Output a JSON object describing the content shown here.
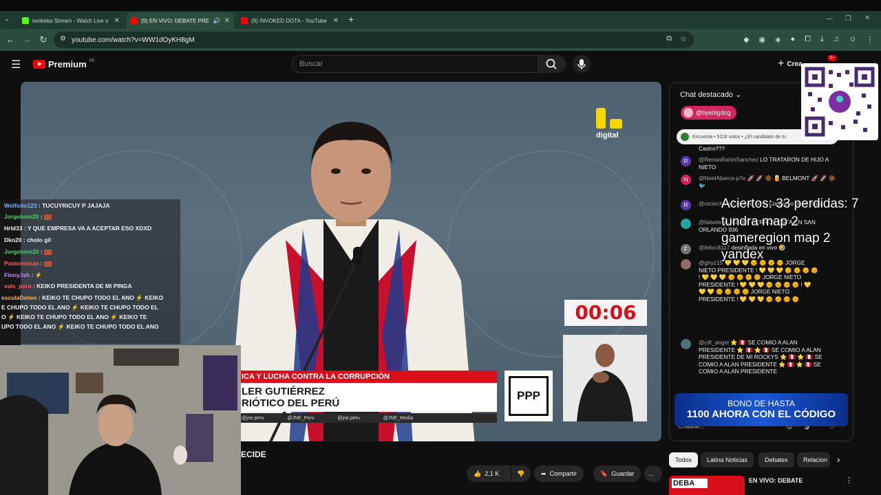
{
  "browser": {
    "tabs": [
      {
        "title": "iwobeka Stream - Watch Live o",
        "fav_color": "#53fc18"
      },
      {
        "title": "(9) EN VIVO: DEBATE PRESI",
        "fav_color": "#ff0000"
      },
      {
        "title": "(9) INVOKED DOTA - YouTube",
        "fav_color": "#ff0000"
      }
    ],
    "new_tab": "+",
    "url": "youtube.com/watch?v=WW1dOyKH8gM"
  },
  "youtube": {
    "logo_text": "Premium",
    "logo_badge": "PE",
    "search_placeholder": "Buscar",
    "create_label": "Crea",
    "notif_count": "9+"
  },
  "video": {
    "timer": "00:06",
    "lower_third_top": "ICA Y LUCHA CONTRA LA CORRUPCIÓN",
    "lower_third_name": "LER GUTIÉRREZ",
    "lower_third_party": "RIÓTICO DEL PERÚ",
    "social": [
      "@jne.peru",
      "@JNE_Peru",
      "@jne.peru",
      "@JNE_Media"
    ],
    "party_logo": "PPP",
    "channel_logo_text": "digital"
  },
  "stream_chat": [
    {
      "user": "Wolfsito123",
      "text": "TUCUYRICUY P JAJAJA",
      "color": "#7fb4ff"
    },
    {
      "user": "Jorgeboni20",
      "text": "",
      "color": "#4fd16b"
    },
    {
      "user": "Hrld33",
      "text": "Y QUE EMPRESA VA A ACEPTAR ESO XDXD",
      "color": "#f1f1f1"
    },
    {
      "user": "Dkn20",
      "text": "cholo gil",
      "color": "#f1f1f1"
    },
    {
      "user": "Jorgeboni20",
      "text": "",
      "color": "#4fd16b"
    },
    {
      "user": "Pantomimas",
      "text": "",
      "color": "#ff5c5c"
    },
    {
      "user": "FinnyJsh",
      "text": "",
      "color": "#c58cff"
    },
    {
      "user": "vals_peru",
      "text": "KEIKO PRESIDENTA DE MI PINGA",
      "color": "#ff5c5c"
    },
    {
      "user": "esculaDelwo",
      "text": "KEIKO TE CHUPO TODO EL ANO",
      "color": "#ffb347"
    }
  ],
  "stream_chat_wrap": [
    "KEIKO",
    "E CHUPO TODO EL ANO",
    "KEIKO TE CHUPO TODO EL",
    "O",
    "KEIKO TE CHUPO TODO EL ANO",
    "KEIKO TE",
    "UPO TODO EL ANO",
    "KEIKO TE CHUPO TODO EL ANO"
  ],
  "below_video": {
    "title_fragment": "ECIDE",
    "likes": "2,1 K",
    "share": "Compartir",
    "save": "Guardar",
    "more": "..."
  },
  "chat_panel": {
    "header": "Chat destacado",
    "pinned_user": "@byebigdog",
    "poll_text": "Encuesta • 5118 votos • ¿El candidato de tu",
    "messages": [
      {
        "user": "",
        "text": "Castro???",
        "avatar": "",
        "avatar_color": "#5b5b5b"
      },
      {
        "user": "@RenanRahinSanchez",
        "text": "LO TRATARON DE HIJO A NIETO",
        "avatar": "R",
        "avatar_color": "#5e35b1"
      },
      {
        "user": "@NoelAbarca-p7e",
        "text": "🚀 🚀 🔆 🥫 BELMONT 🚀 🚀 🔆 🐦",
        "avatar": "N",
        "avatar_color": "#d81b60"
      },
      {
        "user": "@rociochavez",
        "text": "lavado en el Congreso de la mafia",
        "avatar": "R",
        "avatar_color": "#5e35b1"
      },
      {
        "user": "@falsete",
        "text": "VLADIMIR CERRON ESTÁ EN SAN ORLANDO 936",
        "avatar": "",
        "avatar_color": "#26a69a"
      },
      {
        "user": "@felixc8117",
        "text": "desinflada en vivo 🤣",
        "avatar": "F",
        "avatar_color": "#757575"
      },
      {
        "user": "@ghyz15",
        "text": "💛 💛 💛 🌞 🌞 🌞 🌞 JORGE NIETO PRESIDENTE ! 💛 💛 💛 🌞 🌞 🌞 🌞 ! 💛 💛 💛 🌞 🌞 🌞 🌞 JORGE NIETO PRESIDENTE ! 💛 💛 💛 🌞 🌞 🌞 🌞 ! 💛 💛 💛 🌞 🌞 🌞 🌞 JORGE NIETO PRESIDENTE ! 💛 💛 💛 🌞 🌞 🌞 🌞",
        "avatar": "",
        "avatar_color": "#8d6e63"
      },
      {
        "user": "@cift_angel",
        "text": "⭐ 🇵🇪 SE COMIO A ALAN PRESIDENTE ⭐ 🇵🇪 ⭐ 🇵🇪 SE COMIO A ALAN PRESIDENTE DE MI ROCKYS ⭐ 🇵🇪 ⭐ 🇵🇪 SE COMIO A ALAN PRESIDENTE ⭐ 🇵🇪 ⭐ 🇵🇪 SE COMIO A ALAN PRESIDENTE",
        "avatar": "",
        "avatar_color": "#546e7a"
      }
    ],
    "input_placeholder": "Chatear...",
    "banner_line1": "BONO DE HASTA",
    "banner_line2": "1100 AHORA CON EL CÓDIGO"
  },
  "overlay": {
    "line1": "Aciertos: 33 perdidas: 7",
    "line2": "tundra map 2",
    "line3": "gameregion map 2",
    "line4": "yandex"
  },
  "filters": [
    "Todos",
    "Latina Noticias",
    "Debates",
    "Relacion"
  ],
  "related": {
    "title": "EN VIVO: DEBATE",
    "thumb_text": "DEBA"
  }
}
